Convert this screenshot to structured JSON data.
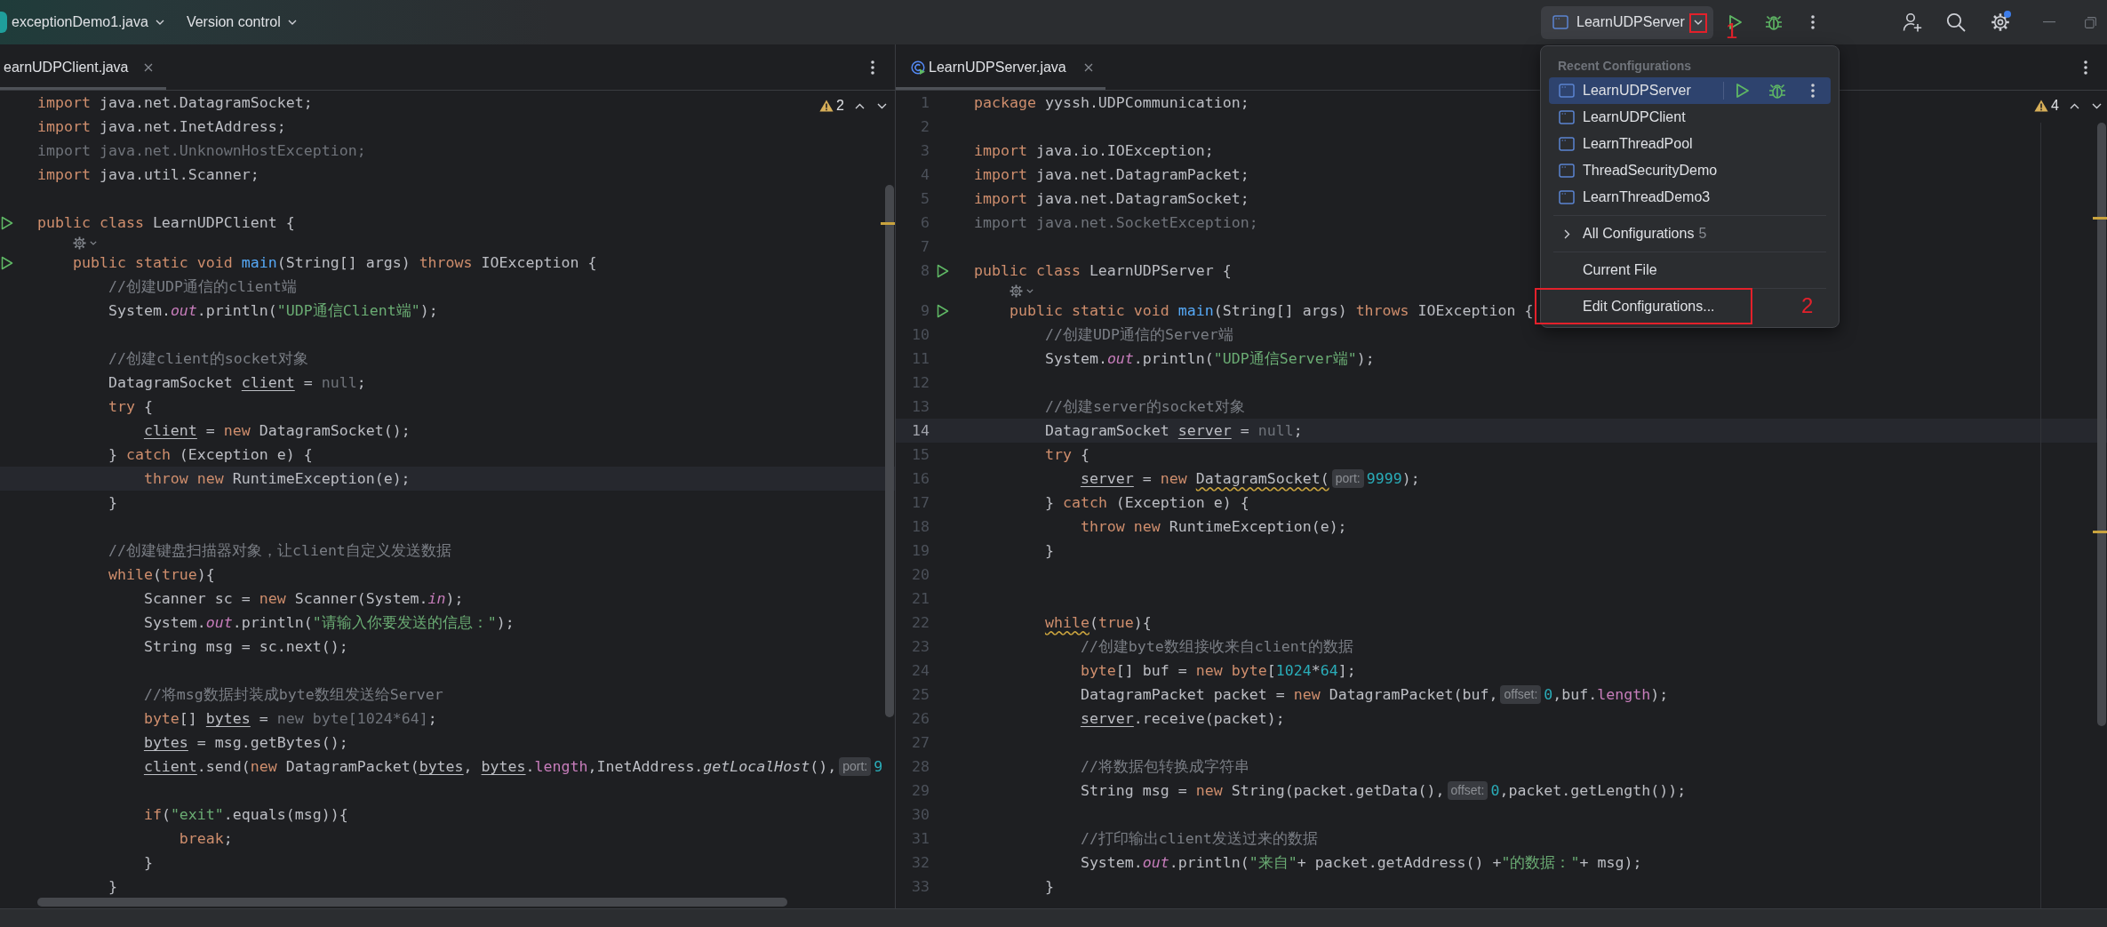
{
  "toolbar": {
    "project": "exceptionDemo1.java",
    "vcs": "Version control",
    "run_config": {
      "label": "LearnUDPServer",
      "annotation": "1"
    }
  },
  "run_popup": {
    "header": "Recent Configurations",
    "recent": [
      {
        "label": "LearnUDPServer",
        "selected": true
      },
      {
        "label": "LearnUDPClient",
        "selected": false
      },
      {
        "label": "LearnThreadPool",
        "selected": false
      },
      {
        "label": "ThreadSecurityDemo",
        "selected": false
      },
      {
        "label": "LearnThreadDemo3",
        "selected": false
      }
    ],
    "actions": [
      {
        "kind": "submenu",
        "label": "All Configurations",
        "count": "5"
      },
      {
        "kind": "item",
        "label": "Current File"
      },
      {
        "kind": "item",
        "label": "Edit Configurations...",
        "annotation": "2"
      }
    ]
  },
  "left_editor": {
    "tabs": [
      {
        "label": "earnUDPClient.java",
        "file_icon": false,
        "selected": true
      }
    ],
    "warnings": "2",
    "lines": [
      {
        "kind": "code",
        "run": false,
        "current": false,
        "tokens": [
          {
            "kind": "kw",
            "text": "import"
          },
          {
            "kind": "plain",
            "text": " java.net.DatagramSocket;"
          }
        ]
      },
      {
        "kind": "code",
        "run": false,
        "current": false,
        "tokens": [
          {
            "kind": "kw",
            "text": "import"
          },
          {
            "kind": "plain",
            "text": " java.net.InetAddress;"
          }
        ]
      },
      {
        "kind": "code",
        "run": false,
        "current": false,
        "tokens": [
          {
            "kind": "dim",
            "text": "import java.net.UnknownHostException;"
          }
        ]
      },
      {
        "kind": "code",
        "run": false,
        "current": false,
        "tokens": [
          {
            "kind": "kw",
            "text": "import"
          },
          {
            "kind": "plain",
            "text": " java.util.Scanner;"
          }
        ]
      },
      {
        "kind": "code",
        "run": false,
        "current": false
      },
      {
        "kind": "code",
        "run": true,
        "current": false,
        "tokens": [
          {
            "kind": "kw",
            "text": "public class"
          },
          {
            "kind": "plain",
            "text": " LearnUDPClient {"
          }
        ]
      },
      {
        "kind": "vision"
      },
      {
        "kind": "code",
        "run": true,
        "current": false,
        "tokens": [
          {
            "kind": "kw",
            "text": "    public static void "
          },
          {
            "kind": "decl",
            "text": "main"
          },
          {
            "kind": "plain",
            "text": "(String[] args) "
          },
          {
            "kind": "kw",
            "text": "throws"
          },
          {
            "kind": "plain",
            "text": " IOException {"
          }
        ]
      },
      {
        "kind": "code",
        "run": false,
        "current": false,
        "tokens": [
          {
            "kind": "com",
            "text": "        //创建UDP通信的client端"
          }
        ]
      },
      {
        "kind": "code",
        "run": false,
        "current": false,
        "tokens": [
          {
            "kind": "plain",
            "text": "        System."
          },
          {
            "kind": "sfield",
            "text": "out"
          },
          {
            "kind": "plain",
            "text": ".println("
          },
          {
            "kind": "str",
            "text": "\"UDP通信Client端\""
          },
          {
            "kind": "plain",
            "text": ");"
          }
        ]
      },
      {
        "kind": "code",
        "run": false,
        "current": false
      },
      {
        "kind": "code",
        "run": false,
        "current": false,
        "tokens": [
          {
            "kind": "com",
            "text": "        //创建client的socket对象"
          }
        ]
      },
      {
        "kind": "code",
        "run": false,
        "current": false,
        "tokens": [
          {
            "kind": "plain",
            "text": "        DatagramSocket "
          },
          {
            "kind": "var",
            "text": "client"
          },
          {
            "kind": "plain",
            "text": " = "
          },
          {
            "kind": "dim",
            "text": "null"
          },
          {
            "kind": "plain",
            "text": ";"
          }
        ]
      },
      {
        "kind": "code",
        "run": false,
        "current": false,
        "tokens": [
          {
            "kind": "kw",
            "text": "        try"
          },
          {
            "kind": "plain",
            "text": " {"
          }
        ]
      },
      {
        "kind": "code",
        "run": false,
        "current": false,
        "tokens": [
          {
            "kind": "var",
            "text": "            client"
          },
          {
            "kind": "plain",
            "text": " = "
          },
          {
            "kind": "kw",
            "text": "new"
          },
          {
            "kind": "plain",
            "text": " DatagramSocket();"
          }
        ]
      },
      {
        "kind": "code",
        "run": false,
        "current": false,
        "tokens": [
          {
            "kind": "plain",
            "text": "        } "
          },
          {
            "kind": "kw",
            "text": "catch"
          },
          {
            "kind": "plain",
            "text": " (Exception e) {"
          }
        ]
      },
      {
        "kind": "code",
        "run": false,
        "current": true,
        "tokens": [
          {
            "kind": "kw",
            "text": "            throw new"
          },
          {
            "kind": "plain",
            "text": " RuntimeException(e);"
          }
        ]
      },
      {
        "kind": "code",
        "run": false,
        "current": false,
        "tokens": [
          {
            "kind": "plain",
            "text": "        }"
          }
        ]
      },
      {
        "kind": "code",
        "run": false,
        "current": false
      },
      {
        "kind": "code",
        "run": false,
        "current": false,
        "tokens": [
          {
            "kind": "com",
            "text": "        //创建键盘扫描器对象，让client自定义发送数据"
          }
        ]
      },
      {
        "kind": "code",
        "run": false,
        "current": false,
        "tokens": [
          {
            "kind": "kw",
            "text": "        while"
          },
          {
            "kind": "plain",
            "text": "("
          },
          {
            "kind": "kw",
            "text": "true"
          },
          {
            "kind": "plain",
            "text": "){"
          }
        ]
      },
      {
        "kind": "code",
        "run": false,
        "current": false,
        "tokens": [
          {
            "kind": "plain",
            "text": "            Scanner sc = "
          },
          {
            "kind": "kw",
            "text": "new"
          },
          {
            "kind": "plain",
            "text": " Scanner(System."
          },
          {
            "kind": "sfield",
            "text": "in"
          },
          {
            "kind": "plain",
            "text": ");"
          }
        ]
      },
      {
        "kind": "code",
        "run": false,
        "current": false,
        "tokens": [
          {
            "kind": "plain",
            "text": "            System."
          },
          {
            "kind": "sfield",
            "text": "out"
          },
          {
            "kind": "plain",
            "text": ".println("
          },
          {
            "kind": "str",
            "text": "\"请输入你要发送的信息：\""
          },
          {
            "kind": "plain",
            "text": ");"
          }
        ]
      },
      {
        "kind": "code",
        "run": false,
        "current": false,
        "tokens": [
          {
            "kind": "plain",
            "text": "            String msg = sc.next();"
          }
        ]
      },
      {
        "kind": "code",
        "run": false,
        "current": false
      },
      {
        "kind": "code",
        "run": false,
        "current": false,
        "tokens": [
          {
            "kind": "com",
            "text": "            //将msg数据封装成byte数组发送给Server"
          }
        ]
      },
      {
        "kind": "code",
        "run": false,
        "current": false,
        "tokens": [
          {
            "kind": "kw",
            "text": "            byte"
          },
          {
            "kind": "plain",
            "text": "[] "
          },
          {
            "kind": "var",
            "text": "bytes"
          },
          {
            "kind": "plain",
            "text": " = "
          },
          {
            "kind": "dim",
            "text": "new byte[1024*64]"
          },
          {
            "kind": "plain",
            "text": ";"
          }
        ]
      },
      {
        "kind": "code",
        "run": false,
        "current": false,
        "tokens": [
          {
            "kind": "var",
            "text": "            bytes"
          },
          {
            "kind": "plain",
            "text": " = msg.getBytes();"
          }
        ]
      },
      {
        "kind": "code",
        "run": false,
        "current": false,
        "tokens": [
          {
            "kind": "var",
            "text": "            client"
          },
          {
            "kind": "plain",
            "text": ".send("
          },
          {
            "kind": "kw",
            "text": "new"
          },
          {
            "kind": "plain",
            "text": " DatagramPacket("
          },
          {
            "kind": "var",
            "text": "bytes"
          },
          {
            "kind": "plain",
            "text": ", "
          },
          {
            "kind": "var",
            "text": "bytes"
          },
          {
            "kind": "plain",
            "text": "."
          },
          {
            "kind": "field",
            "text": "length"
          },
          {
            "kind": "plain",
            "text": ",InetAddress."
          },
          {
            "kind": "scall",
            "text": "getLocalHost"
          },
          {
            "kind": "plain",
            "text": "(),"
          },
          {
            "kind": "hint",
            "text": "port:"
          },
          {
            "kind": "num",
            "text": "9"
          }
        ]
      },
      {
        "kind": "code",
        "run": false,
        "current": false
      },
      {
        "kind": "code",
        "run": false,
        "current": false,
        "tokens": [
          {
            "kind": "kw",
            "text": "            if"
          },
          {
            "kind": "plain",
            "text": "("
          },
          {
            "kind": "str",
            "text": "\"exit\""
          },
          {
            "kind": "plain",
            "text": ".equals(msg)){"
          }
        ]
      },
      {
        "kind": "code",
        "run": false,
        "current": false,
        "tokens": [
          {
            "kind": "kw",
            "text": "                break"
          },
          {
            "kind": "plain",
            "text": ";"
          }
        ]
      },
      {
        "kind": "code",
        "run": false,
        "current": false,
        "tokens": [
          {
            "kind": "plain",
            "text": "            }"
          }
        ]
      },
      {
        "kind": "code",
        "run": false,
        "current": false,
        "tokens": [
          {
            "kind": "plain",
            "text": "        }"
          }
        ]
      }
    ]
  },
  "right_editor": {
    "tabs": [
      {
        "label": "LearnUDPServer.java",
        "file_icon": true,
        "selected": true
      }
    ],
    "warnings": "4",
    "lines": [
      {
        "kind": "code",
        "number": "1",
        "run": false,
        "current": false,
        "tokens": [
          {
            "kind": "kw",
            "text": "package"
          },
          {
            "kind": "plain",
            "text": " yyssh.UDPCommunication;"
          }
        ]
      },
      {
        "kind": "code",
        "number": "2",
        "run": false,
        "current": false
      },
      {
        "kind": "code",
        "number": "3",
        "run": false,
        "current": false,
        "tokens": [
          {
            "kind": "kw",
            "text": "import"
          },
          {
            "kind": "plain",
            "text": " java.io.IOException;"
          }
        ]
      },
      {
        "kind": "code",
        "number": "4",
        "run": false,
        "current": false,
        "tokens": [
          {
            "kind": "kw",
            "text": "import"
          },
          {
            "kind": "plain",
            "text": " java.net.DatagramPacket;"
          }
        ]
      },
      {
        "kind": "code",
        "number": "5",
        "run": false,
        "current": false,
        "tokens": [
          {
            "kind": "kw",
            "text": "import"
          },
          {
            "kind": "plain",
            "text": " java.net.DatagramSocket;"
          }
        ]
      },
      {
        "kind": "code",
        "number": "6",
        "run": false,
        "current": false,
        "tokens": [
          {
            "kind": "dim",
            "text": "import java.net.SocketException;"
          }
        ]
      },
      {
        "kind": "code",
        "number": "7",
        "run": false,
        "current": false
      },
      {
        "kind": "code",
        "number": "8",
        "run": true,
        "current": false,
        "tokens": [
          {
            "kind": "kw",
            "text": "public class"
          },
          {
            "kind": "plain",
            "text": " LearnUDPServer {"
          }
        ]
      },
      {
        "kind": "vision"
      },
      {
        "kind": "code",
        "number": "9",
        "run": true,
        "current": false,
        "tokens": [
          {
            "kind": "kw",
            "text": "    public static void "
          },
          {
            "kind": "decl",
            "text": "main"
          },
          {
            "kind": "plain",
            "text": "(String[] args) "
          },
          {
            "kind": "kw",
            "text": "throws"
          },
          {
            "kind": "plain",
            "text": " IOException {"
          }
        ]
      },
      {
        "kind": "code",
        "number": "10",
        "run": false,
        "current": false,
        "tokens": [
          {
            "kind": "com",
            "text": "        //创建UDP通信的Server端"
          }
        ]
      },
      {
        "kind": "code",
        "number": "11",
        "run": false,
        "current": false,
        "tokens": [
          {
            "kind": "plain",
            "text": "        System."
          },
          {
            "kind": "sfield",
            "text": "out"
          },
          {
            "kind": "plain",
            "text": ".println("
          },
          {
            "kind": "str",
            "text": "\"UDP通信Server端\""
          },
          {
            "kind": "plain",
            "text": ");"
          }
        ]
      },
      {
        "kind": "code",
        "number": "12",
        "run": false,
        "current": false
      },
      {
        "kind": "code",
        "number": "13",
        "run": false,
        "current": false,
        "tokens": [
          {
            "kind": "com",
            "text": "        //创建server的socket对象"
          }
        ]
      },
      {
        "kind": "code",
        "number": "14",
        "run": false,
        "current": true,
        "tokens": [
          {
            "kind": "plain",
            "text": "        DatagramSocket "
          },
          {
            "kind": "var",
            "text": "server"
          },
          {
            "kind": "plain",
            "text": " = "
          },
          {
            "kind": "dim",
            "text": "null"
          },
          {
            "kind": "plain",
            "text": ";"
          }
        ]
      },
      {
        "kind": "code",
        "number": "15",
        "run": false,
        "current": false,
        "tokens": [
          {
            "kind": "kw",
            "text": "        try"
          },
          {
            "kind": "plain",
            "text": " {"
          }
        ]
      },
      {
        "kind": "code",
        "number": "16",
        "run": false,
        "current": false,
        "tokens": [
          {
            "kind": "var",
            "text": "            server"
          },
          {
            "kind": "plain",
            "text": " = "
          },
          {
            "kind": "kw",
            "text": "new "
          },
          {
            "kind": "warn",
            "text": "DatagramSocket("
          },
          {
            "kind": "hint",
            "text": "port:"
          },
          {
            "kind": "num",
            "text": "9999"
          },
          {
            "kind": "plain",
            "text": ");"
          }
        ]
      },
      {
        "kind": "code",
        "number": "17",
        "run": false,
        "current": false,
        "tokens": [
          {
            "kind": "plain",
            "text": "        } "
          },
          {
            "kind": "kw",
            "text": "catch"
          },
          {
            "kind": "plain",
            "text": " (Exception e) {"
          }
        ]
      },
      {
        "kind": "code",
        "number": "18",
        "run": false,
        "current": false,
        "tokens": [
          {
            "kind": "kw",
            "text": "            throw new"
          },
          {
            "kind": "plain",
            "text": " RuntimeException(e);"
          }
        ]
      },
      {
        "kind": "code",
        "number": "19",
        "run": false,
        "current": false,
        "tokens": [
          {
            "kind": "plain",
            "text": "        }"
          }
        ]
      },
      {
        "kind": "code",
        "number": "20",
        "run": false,
        "current": false
      },
      {
        "kind": "code",
        "number": "21",
        "run": false,
        "current": false
      },
      {
        "kind": "code",
        "number": "22",
        "run": false,
        "current": false,
        "tokens": [
          {
            "kind": "kwwarn",
            "text": "        while"
          },
          {
            "kind": "plain",
            "text": "("
          },
          {
            "kind": "kw",
            "text": "true"
          },
          {
            "kind": "plain",
            "text": "){"
          }
        ]
      },
      {
        "kind": "code",
        "number": "23",
        "run": false,
        "current": false,
        "tokens": [
          {
            "kind": "com",
            "text": "            //创建byte数组接收来自client的数据"
          }
        ]
      },
      {
        "kind": "code",
        "number": "24",
        "run": false,
        "current": false,
        "tokens": [
          {
            "kind": "kw",
            "text": "            byte"
          },
          {
            "kind": "plain",
            "text": "[] buf = "
          },
          {
            "kind": "kw",
            "text": "new byte"
          },
          {
            "kind": "plain",
            "text": "["
          },
          {
            "kind": "num",
            "text": "1024"
          },
          {
            "kind": "plain",
            "text": "*"
          },
          {
            "kind": "num",
            "text": "64"
          },
          {
            "kind": "plain",
            "text": "];"
          }
        ]
      },
      {
        "kind": "code",
        "number": "25",
        "run": false,
        "current": false,
        "tokens": [
          {
            "kind": "plain",
            "text": "            DatagramPacket packet = "
          },
          {
            "kind": "kw",
            "text": "new"
          },
          {
            "kind": "plain",
            "text": " DatagramPacket(buf,"
          },
          {
            "kind": "hint",
            "text": "offset:"
          },
          {
            "kind": "num",
            "text": "0"
          },
          {
            "kind": "plain",
            "text": ",buf."
          },
          {
            "kind": "field",
            "text": "length"
          },
          {
            "kind": "plain",
            "text": ");"
          }
        ]
      },
      {
        "kind": "code",
        "number": "26",
        "run": false,
        "current": false,
        "tokens": [
          {
            "kind": "var",
            "text": "            server"
          },
          {
            "kind": "plain",
            "text": ".receive(packet);"
          }
        ]
      },
      {
        "kind": "code",
        "number": "27",
        "run": false,
        "current": false
      },
      {
        "kind": "code",
        "number": "28",
        "run": false,
        "current": false,
        "tokens": [
          {
            "kind": "com",
            "text": "            //将数据包转换成字符串"
          }
        ]
      },
      {
        "kind": "code",
        "number": "29",
        "run": false,
        "current": false,
        "tokens": [
          {
            "kind": "plain",
            "text": "            String msg = "
          },
          {
            "kind": "kw",
            "text": "new"
          },
          {
            "kind": "plain",
            "text": " String(packet.getData(),"
          },
          {
            "kind": "hint",
            "text": "offset:"
          },
          {
            "kind": "num",
            "text": "0"
          },
          {
            "kind": "plain",
            "text": ",packet.getLength());"
          }
        ]
      },
      {
        "kind": "code",
        "number": "30",
        "run": false,
        "current": false
      },
      {
        "kind": "code",
        "number": "31",
        "run": false,
        "current": false,
        "tokens": [
          {
            "kind": "com",
            "text": "            //打印输出client发送过来的数据"
          }
        ]
      },
      {
        "kind": "code",
        "number": "32",
        "run": false,
        "current": false,
        "tokens": [
          {
            "kind": "plain",
            "text": "            System."
          },
          {
            "kind": "sfield",
            "text": "out"
          },
          {
            "kind": "plain",
            "text": ".println("
          },
          {
            "kind": "str",
            "text": "\"来自\""
          },
          {
            "kind": "plain",
            "text": "+ packet.getAddress() +"
          },
          {
            "kind": "str",
            "text": "\"的数据：\""
          },
          {
            "kind": "plain",
            "text": "+ msg);"
          }
        ]
      },
      {
        "kind": "code",
        "number": "33",
        "run": false,
        "current": false,
        "tokens": [
          {
            "kind": "plain",
            "text": "        }"
          }
        ]
      }
    ]
  }
}
